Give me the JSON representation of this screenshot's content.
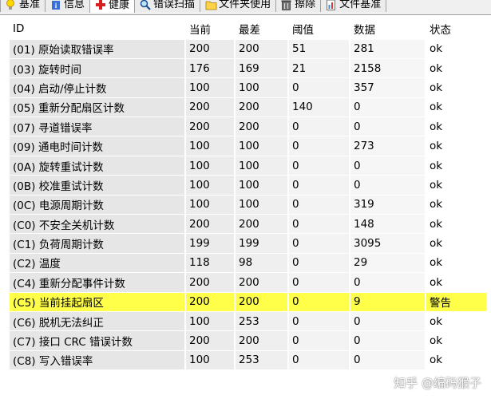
{
  "tabs": [
    {
      "label": "基准",
      "icon": "bulb-icon",
      "active": false
    },
    {
      "label": "信息",
      "icon": "info-icon",
      "active": false
    },
    {
      "label": "健康",
      "icon": "health-cross-icon",
      "active": true
    },
    {
      "label": "错误扫描",
      "icon": "magnifier-icon",
      "active": false
    },
    {
      "label": "文件夹使用",
      "icon": "folder-icon",
      "active": false
    },
    {
      "label": "擦除",
      "icon": "trash-icon",
      "active": false
    },
    {
      "label": "文件基准",
      "icon": "file-benchmark-icon",
      "active": false
    }
  ],
  "table": {
    "headers": [
      "ID",
      "当前",
      "最差",
      "阈值",
      "数据",
      "状态"
    ],
    "rows": [
      {
        "id": "(01) 原始读取错误率",
        "cur": "200",
        "worst": "200",
        "thr": "51",
        "data": "281",
        "status": "ok"
      },
      {
        "id": "(03) 旋转时间",
        "cur": "176",
        "worst": "169",
        "thr": "21",
        "data": "2158",
        "status": "ok"
      },
      {
        "id": "(04) 启动/停止计数",
        "cur": "100",
        "worst": "100",
        "thr": "0",
        "data": "357",
        "status": "ok"
      },
      {
        "id": "(05) 重新分配扇区计数",
        "cur": "200",
        "worst": "200",
        "thr": "140",
        "data": "0",
        "status": "ok"
      },
      {
        "id": "(07) 寻道错误率",
        "cur": "200",
        "worst": "200",
        "thr": "0",
        "data": "0",
        "status": "ok"
      },
      {
        "id": "(09) 通电时间计数",
        "cur": "100",
        "worst": "100",
        "thr": "0",
        "data": "273",
        "status": "ok"
      },
      {
        "id": "(0A) 旋转重试计数",
        "cur": "100",
        "worst": "100",
        "thr": "0",
        "data": "0",
        "status": "ok"
      },
      {
        "id": "(0B) 校准重试计数",
        "cur": "100",
        "worst": "100",
        "thr": "0",
        "data": "0",
        "status": "ok"
      },
      {
        "id": "(0C) 电源周期计数",
        "cur": "100",
        "worst": "100",
        "thr": "0",
        "data": "319",
        "status": "ok"
      },
      {
        "id": "(C0) 不安全关机计数",
        "cur": "200",
        "worst": "200",
        "thr": "0",
        "data": "148",
        "status": "ok"
      },
      {
        "id": "(C1) 负荷周期计数",
        "cur": "199",
        "worst": "199",
        "thr": "0",
        "data": "3095",
        "status": "ok"
      },
      {
        "id": "(C2) 温度",
        "cur": "118",
        "worst": "98",
        "thr": "0",
        "data": "29",
        "status": "ok"
      },
      {
        "id": "(C4) 重新分配事件计数",
        "cur": "200",
        "worst": "200",
        "thr": "0",
        "data": "0",
        "status": "ok"
      },
      {
        "id": "(C5) 当前挂起扇区",
        "cur": "200",
        "worst": "200",
        "thr": "0",
        "data": "9",
        "status": "警告",
        "highlight": true
      },
      {
        "id": "(C6) 脱机无法纠正",
        "cur": "100",
        "worst": "253",
        "thr": "0",
        "data": "0",
        "status": "ok"
      },
      {
        "id": "(C7) 接口 CRC 错误计数",
        "cur": "200",
        "worst": "200",
        "thr": "0",
        "data": "0",
        "status": "ok"
      },
      {
        "id": "(C8) 写入错误率",
        "cur": "100",
        "worst": "253",
        "thr": "0",
        "data": "0",
        "status": "ok"
      }
    ]
  },
  "watermark": "知乎 @编码猴子",
  "colors": {
    "highlight": "#ffff4a",
    "health_tab_icon": "#d81f1f"
  }
}
